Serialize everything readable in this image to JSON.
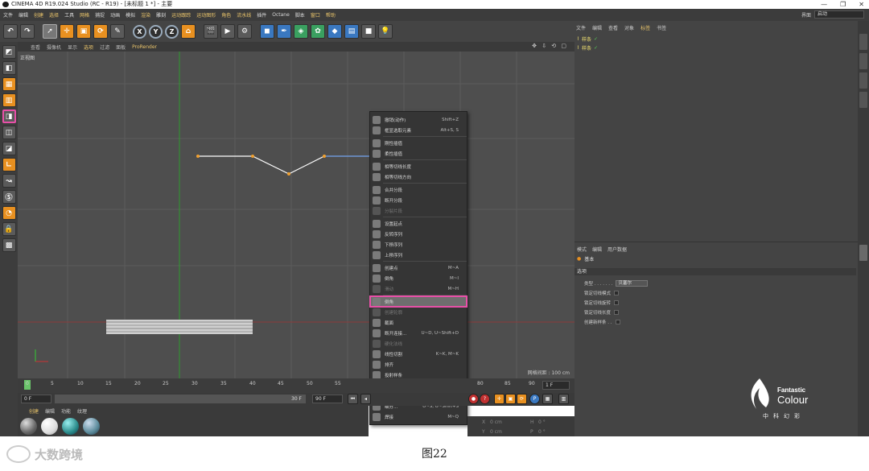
{
  "window": {
    "title": "CINEMA 4D R19.024 Studio (RC - R19) - [未标题 1 *] - 主要",
    "controls": [
      "—",
      "❐",
      "✕"
    ]
  },
  "menubar": {
    "items": [
      "文件",
      "编辑",
      "创建",
      "选择",
      "工具",
      "网格",
      "捕捉",
      "动画",
      "模拟",
      "渲染",
      "雕刻",
      "运动跟踪",
      "运动图形",
      "角色",
      "流水线",
      "插件",
      "Octane",
      "脚本",
      "窗口",
      "帮助"
    ],
    "layout_label": "界面",
    "layout_value": "启动"
  },
  "toolbar": {
    "axis_x": "X",
    "axis_y": "Y",
    "axis_z": "Z"
  },
  "viewport": {
    "menu": [
      "查看",
      "摄像机",
      "显示",
      "选项",
      "过滤",
      "面板",
      "ProRender"
    ],
    "label": "正视图",
    "grid_spacing": "网格间距 : 100 cm",
    "nav_icons": "✥ ⇩ ⟲ ▢"
  },
  "context_menu": {
    "items": [
      {
        "label": "撤销(动作)",
        "shortcut": "Shift+Z"
      },
      {
        "label": "框显选取元素",
        "shortcut": "Alt+S, S"
      },
      {
        "label": "刚性插值",
        "shortcut": ""
      },
      {
        "label": "柔性插值",
        "shortcut": ""
      },
      {
        "label": "相等切线长度",
        "shortcut": ""
      },
      {
        "label": "相等切线方向",
        "shortcut": ""
      },
      {
        "label": "合并分段",
        "shortcut": ""
      },
      {
        "label": "断开分段",
        "shortcut": ""
      },
      {
        "label": "分裂片段",
        "shortcut": ""
      },
      {
        "label": "设置起点",
        "shortcut": ""
      },
      {
        "label": "反转序列",
        "shortcut": ""
      },
      {
        "label": "下移序列",
        "shortcut": ""
      },
      {
        "label": "上移序列",
        "shortcut": ""
      },
      {
        "label": "创建点",
        "shortcut": "M~A"
      },
      {
        "label": "倒角",
        "shortcut": "M~I"
      },
      {
        "label": "滑动",
        "shortcut": "M~H"
      },
      {
        "label": "倒角",
        "shortcut": ""
      },
      {
        "label": "创建轮廓",
        "shortcut": ""
      },
      {
        "label": "截面",
        "shortcut": ""
      },
      {
        "label": "断开连接...",
        "shortcut": "U~D, U~Shift+D"
      },
      {
        "label": "硬化法线",
        "shortcut": ""
      },
      {
        "label": "线性切割",
        "shortcut": "K~K, M~K"
      },
      {
        "label": "排齐",
        "shortcut": ""
      },
      {
        "label": "投射样条",
        "shortcut": ""
      },
      {
        "label": "平滑",
        "shortcut": ""
      },
      {
        "label": "分裂",
        "shortcut": "U~P"
      },
      {
        "label": "细分...",
        "shortcut": "U~S, U~Shift+S"
      },
      {
        "label": "焊接",
        "shortcut": "M~Q"
      }
    ]
  },
  "timeline": {
    "ticks": [
      "0",
      "5",
      "10",
      "15",
      "20",
      "25",
      "30",
      "35",
      "40",
      "45",
      "50",
      "55",
      "80",
      "85",
      "90"
    ],
    "current_frame": "0 F",
    "start_field": "0 F",
    "end_field": "90 F",
    "slider_value": "30 F",
    "fps_field": "1 F"
  },
  "material_manager": {
    "menu": [
      "创建",
      "编辑",
      "功能",
      "纹理"
    ]
  },
  "coords": {
    "x_label": "X",
    "x_value": "0 cm",
    "y_label": "Y",
    "y_value": "0 cm",
    "h_label": "H",
    "h_value": "0 °",
    "p_label": "P",
    "p_value": "0 °"
  },
  "object_manager": {
    "menu": [
      "文件",
      "编辑",
      "查看",
      "对象",
      "标签",
      "书签"
    ],
    "objects": [
      {
        "name": "样条"
      },
      {
        "name": "样条"
      }
    ]
  },
  "attribute_manager": {
    "menu": [
      "模式",
      "编辑",
      "用户数据"
    ],
    "mode_label": "基本",
    "section": "选项",
    "type_label": "类型 . . . . . . .",
    "type_value": "贝塞尔",
    "rows": [
      "锁定切线模式",
      "锁定切线旋转",
      "锁定切线长度",
      "创建新样条 . ."
    ]
  },
  "logo": {
    "title": "Fantastic",
    "subtitle": "Colour",
    "cn": "中科幻彩"
  },
  "caption": "图22",
  "watermark": "大数跨境"
}
